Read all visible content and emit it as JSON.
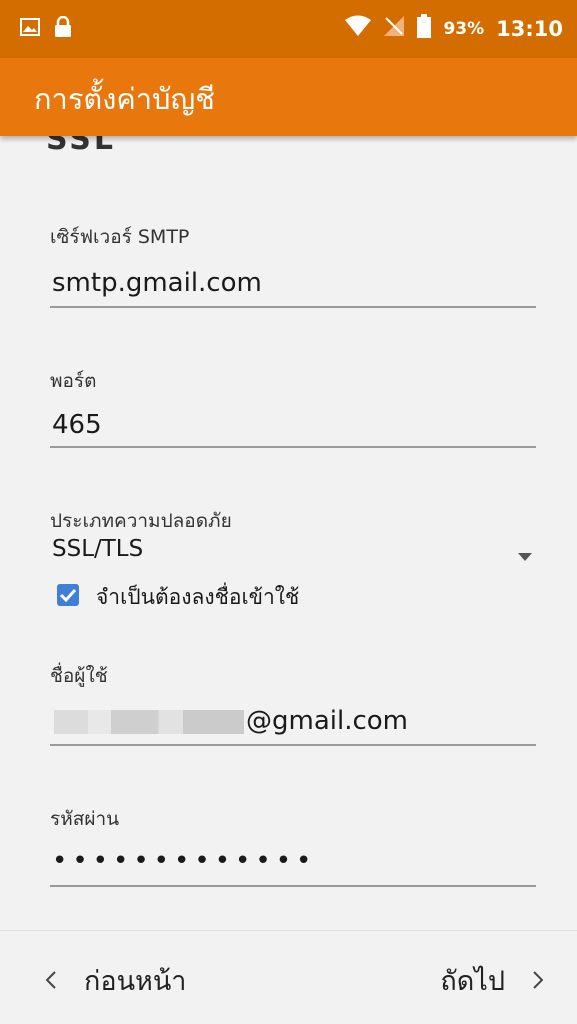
{
  "status_bar": {
    "left_icons": [
      "image-icon",
      "lock-icon"
    ],
    "right_icons": [
      "wifi-icon",
      "signal-off-icon",
      "battery-icon"
    ],
    "battery": "93%",
    "time": "13:10"
  },
  "app_bar": {
    "title": "การตั้งค่าบัญชี"
  },
  "form": {
    "cutoff_text": "SSL",
    "smtp": {
      "label": "เซิร์ฟเวอร์ SMTP",
      "value": "smtp.gmail.com"
    },
    "port": {
      "label": "พอร์ต",
      "value": "465"
    },
    "security": {
      "label": "ประเภทความปลอดภัย",
      "value": "SSL/TLS"
    },
    "require_signin": {
      "label": "จำเป็นต้องลงชื่อเข้าใช้",
      "checked": true
    },
    "username": {
      "label": "ชื่อผู้ใช้",
      "value_suffix": "@gmail.com"
    },
    "password": {
      "label": "รหัสผ่าน",
      "value": "•••••••••••••"
    }
  },
  "nav": {
    "previous": "ก่อนหน้า",
    "next": "ถัดไป"
  },
  "colors": {
    "status_bar": "#d46d00",
    "app_bar": "#e8780e",
    "checkbox": "#3f7fd7"
  }
}
